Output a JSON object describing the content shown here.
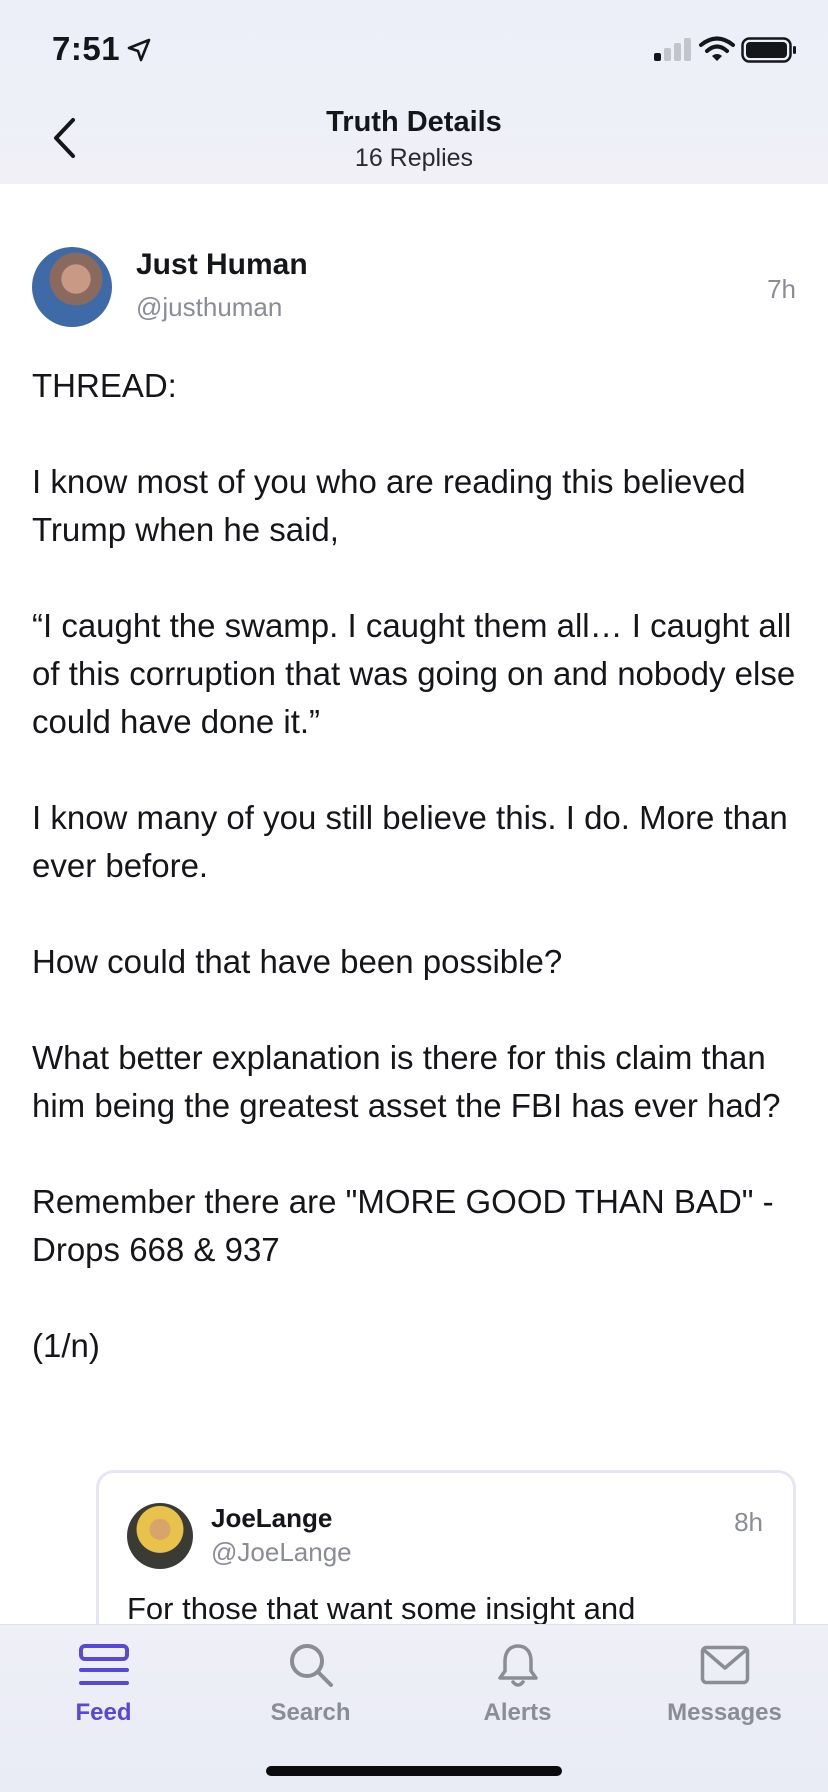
{
  "status_bar": {
    "time": "7:51"
  },
  "header": {
    "title": "Truth Details",
    "subtitle": "16 Replies"
  },
  "post": {
    "author_name": "Just Human",
    "author_handle": "@justhuman",
    "time": "7h",
    "paragraphs": [
      "THREAD:",
      "I know most of you who are reading this believed Trump when he said,",
      "“I caught the swamp. I caught them all… I caught all of this corruption that was going on and nobody else could have done it.”",
      "I know many of you still believe this. I do. More than ever before.",
      "How could that have been possible?",
      "What better explanation is there for this claim than him being the greatest asset the FBI has ever had?",
      "Remember there are \"MORE GOOD THAN BAD\" -Drops 668 & 937",
      "(1/n)"
    ]
  },
  "reply": {
    "author_name": "JoeLange",
    "author_handle": "@JoeLange",
    "time": "8h",
    "text": "For those that want some insight and"
  },
  "tabbar": {
    "feed": "Feed",
    "search": "Search",
    "alerts": "Alerts",
    "messages": "Messages",
    "active": "feed",
    "accent_color": "#5848d6",
    "inactive_color": "#8a8c96"
  }
}
